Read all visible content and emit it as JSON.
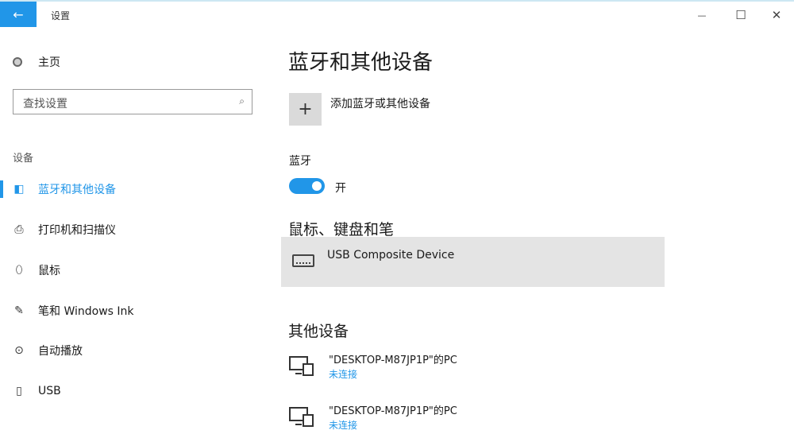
{
  "titlebar": {
    "back_glyph": "←",
    "title": "设置",
    "minimize_glyph": "—",
    "maximize_glyph": "☐",
    "close_glyph": "✕"
  },
  "sidebar": {
    "home_label": "主页",
    "search_placeholder": "查找设置",
    "search_icon": "⌕",
    "section_label": "设备",
    "items": [
      {
        "label": "蓝牙和其他设备",
        "icon": "bluetooth-devices-icon",
        "glyph": "◧",
        "active": true
      },
      {
        "label": "打印机和扫描仪",
        "icon": "printer-icon",
        "glyph": "⎙",
        "active": false
      },
      {
        "label": "鼠标",
        "icon": "mouse-icon",
        "glyph": "⬯",
        "active": false
      },
      {
        "label": "笔和 Windows Ink",
        "icon": "pen-icon",
        "glyph": "✎",
        "active": false
      },
      {
        "label": "自动播放",
        "icon": "autoplay-icon",
        "glyph": "⊙",
        "active": false
      },
      {
        "label": "USB",
        "icon": "usb-icon",
        "glyph": "▯",
        "active": false
      }
    ]
  },
  "main": {
    "title": "蓝牙和其他设备",
    "add_device": {
      "glyph": "+",
      "label": "添加蓝牙或其他设备"
    },
    "bluetooth": {
      "label": "蓝牙",
      "state": "开",
      "on": true
    },
    "mouse_section": {
      "heading": "鼠标、键盘和笔",
      "devices": [
        {
          "name": "USB Composite Device"
        }
      ]
    },
    "other_section": {
      "heading": "其他设备",
      "devices": [
        {
          "name": "\"DESKTOP-M87JP1P\"的PC",
          "status": "未连接"
        },
        {
          "name": "\"DESKTOP-M87JP1P\"的PC",
          "status": "未连接"
        }
      ]
    }
  },
  "colors": {
    "accent": "#2196e8",
    "card_bg": "#e4e4e4"
  }
}
